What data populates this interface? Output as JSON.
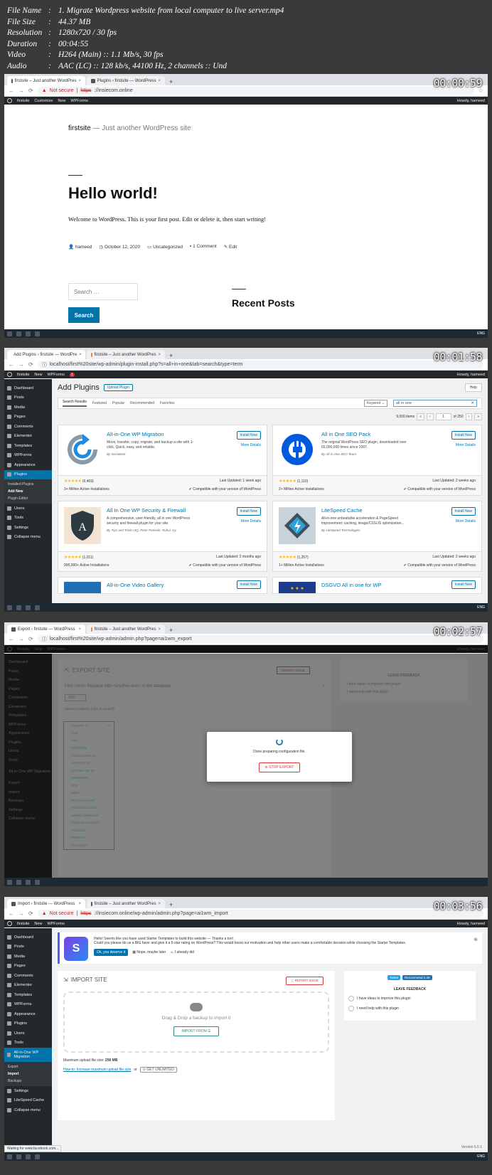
{
  "info": {
    "rows": [
      {
        "k": "File Name",
        "v": "1. Migrate Wordpress website from local computer to live server.mp4"
      },
      {
        "k": "File Size",
        "v": "44.37 MB"
      },
      {
        "k": "Resolution",
        "v": "1280x720 / 30 fps"
      },
      {
        "k": "Duration",
        "v": "00:04:55"
      },
      {
        "k": "Video",
        "v": "H264 (Main) :: 1.1 Mb/s, 30 fps"
      },
      {
        "k": "Audio",
        "v": "AAC (LC) :: 128 kb/s, 44100 Hz, 2 channels :: Und"
      }
    ]
  },
  "frame1": {
    "timestamp": "00:00:59",
    "tabs": [
      "firstsite – Just another WordPres",
      "Plugins ‹ firstsite — WordPress"
    ],
    "not_secure": "Not secure",
    "url_scheme": "https",
    "url_rest": "://insiecom.online",
    "adminbar": [
      "firstsite",
      "Customize",
      "New",
      "WPForms"
    ],
    "howdy": "Howdy, hameed",
    "site_title": "firstsite",
    "tagline": "Just another WordPress site",
    "post_title": "Hello world!",
    "post_body": "Welcome to WordPress. This is your first post. Edit or delete it, then start writing!",
    "meta": [
      "hameed",
      "October 12, 2020",
      "Uncategorized",
      "1 Comment",
      "Edit"
    ],
    "search_placeholder": "Search …",
    "search_button": "Search",
    "recent_posts": "Recent Posts",
    "tray": "ENG"
  },
  "frame2": {
    "timestamp": "00:01:58",
    "tabs": [
      "Add Plugins ‹ firstsite — WordPre",
      "firstsite – Just another WordPres"
    ],
    "url": "localhost/first%20site/wp-admin/plugin-install.php?s=all+in+one&tab=search&type=term",
    "adminbar": [
      "firstsite",
      "New",
      "WPForms"
    ],
    "badge": "1",
    "howdy": "Howdy, hameed",
    "sidebar": [
      "Dashboard",
      "Posts",
      "Media",
      "Pages",
      "Comments",
      "Elementor",
      "Templates",
      "WPForms",
      "Appearance",
      "Plugins"
    ],
    "submenu": [
      "Installed Plugins",
      "Add New",
      "Plugin Editor"
    ],
    "sidebar_after": [
      "Users",
      "Tools",
      "Settings",
      "Collapse menu"
    ],
    "page_title": "Add Plugins",
    "upload_button": "Upload Plugin",
    "help": "Help",
    "filter_tabs": [
      "Search Results",
      "Featured",
      "Popular",
      "Recommended",
      "Favorites"
    ],
    "keyword": "Keyword",
    "search_value": "all in one",
    "items": "9,000 items",
    "page_current": "1",
    "page_total": "of 250",
    "plugins": [
      {
        "name": "All-in-One WP Migration",
        "desc": "Move, transfer, copy, migrate, and backup a site with 1-click. Quick, easy, and reliable.",
        "by": "By ServMask",
        "rating": "(6,469)",
        "updated": "Last Updated: 1 week ago",
        "installs": "3+ Million Active Installations",
        "compat": "Compatible with your version of WordPress"
      },
      {
        "name": "All in One SEO Pack",
        "desc": "The original WordPress SEO plugin, downloaded over 65,000,000 times since 2007.",
        "by": "By All in One SEO Team",
        "rating": "(1,110)",
        "updated": "Last Updated: 2 weeks ago",
        "installs": "2+ Million Active Installations",
        "compat": "Compatible with your version of WordPress"
      },
      {
        "name": "All In One WP Security & Firewall",
        "desc": "A comprehensive, user-friendly, all in one WordPress security and firewall plugin for your site.",
        "by": "By Tips and Tricks HQ, Peter Petreski, Ruhul, Ivy",
        "rating": "(1,011)",
        "updated": "Last Updated: 2 months ago",
        "installs": "900,000+ Active Installations",
        "compat": "Compatible with your version of WordPress"
      },
      {
        "name": "LiteSpeed Cache",
        "desc": "All-in-one unbeatable acceleration & PageSpeed improvement: caching, image/CSS/JS optimization...",
        "by": "By LiteSpeed Technologies",
        "rating": "(1,257)",
        "updated": "Last Updated: 2 weeks ago",
        "installs": "1+ Million Active Installations",
        "compat": "Compatible with your version of WordPress"
      }
    ],
    "plugins_partial": [
      "All-in-One Video Gallery",
      "DSGVO All in one for WP"
    ],
    "install_now": "Install Now",
    "more_details": "More Details",
    "stars": "★★★★★"
  },
  "frame3": {
    "timestamp": "00:02:57",
    "tabs": [
      "Export ‹ firstsite — WordPress",
      "firstsite – Just another WordPres"
    ],
    "url": "localhost/first%20site/wp-admin/admin.php?page=ai1wm_export",
    "export_title": "EXPORT SITE",
    "report_issue": "REPORT ISSUE",
    "find_replace": "Find <text> Replace with <another-text> in the database",
    "add_btn": "ADD",
    "advanced": "Advanced options (click to expand)",
    "export_to": "EXPORT TO",
    "export_options": [
      "FILE",
      "FTP",
      "DROPBOX",
      "GOOGLE DRIVE",
      "AMAZON S3",
      "BACKBLAZE B2",
      "ONEDRIVE",
      "BOX",
      "MEGA",
      "DIGITALOCEAN",
      "GOOGLE CLOUD",
      "AZURE STORAGE",
      "AMAZON GLACIER",
      "PCLOUD",
      "WEBDAV",
      "S3 CLIENT"
    ],
    "leave_feedback": "LEAVE FEEDBACK",
    "feedback_opts": [
      "I have ideas to improve this plugin",
      "I need help with this plugin"
    ],
    "modal_text": "Done preparing configuration file.",
    "stop_export": "STOP EXPORT",
    "sidebar": [
      "Dashboard",
      "Posts",
      "Media",
      "Pages",
      "Comments",
      "Elementor",
      "Templates",
      "WPForms",
      "Appearance",
      "Plugins",
      "Users",
      "Tools",
      "All-in-One WP Migration",
      "Export",
      "Import",
      "Backups",
      "Settings",
      "Collapse menu"
    ]
  },
  "frame4": {
    "timestamp": "00:03:56",
    "tabs": [
      "Import ‹ firstsite — WordPress",
      "firstsite – Just another WordPres"
    ],
    "not_secure": "Not secure",
    "url_scheme": "https",
    "url_rest": "://insiecom.online/wp-admin/admin.php?page=ai1wm_import",
    "adminbar": [
      "firstsite",
      "New",
      "WPForms"
    ],
    "howdy": "Howdy, hameed",
    "notice_l1": "Hello! Seems like you have used Starter Templates to build this website — Thanks a ton!",
    "notice_l2": "Could you please do us a BIG favor and give it a 5-star rating on WordPress? This would boost our motivation and help other users make a comfortable decision while choosing the Starter Templates.",
    "notice_btns": [
      "Ok, you deserve it",
      "Nope, maybe later",
      "I already did"
    ],
    "import_title": "IMPORT SITE",
    "report_issue": "REPORT ISSUE",
    "drop_text": "Drag & Drop a backup to import it",
    "import_from": "IMPORT FROM",
    "max_label": "Maximum upload file size:",
    "max_value": "256 MB",
    "how_link": "How-to: Increase maximum upload file size",
    "or": "or",
    "get_unlimited": "GET UNLIMITED",
    "tweet": "Tweet",
    "recommend": "Recommend 2.4K",
    "leave_feedback": "LEAVE FEEDBACK",
    "feedback_opts": [
      "I have ideas to improve this plugin",
      "I need help with this plugin"
    ],
    "version": "Version 5.5.1",
    "status": "Waiting for www.facebook.com...",
    "sidebar": [
      "Dashboard",
      "Posts",
      "Media",
      "Pages",
      "Comments",
      "Elementor",
      "Templates",
      "WPForms",
      "Appearance",
      "Plugins",
      "Users",
      "Tools"
    ],
    "active_item": "All-in-One WP Migration",
    "submenu": [
      "Export",
      "Import",
      "Backups"
    ],
    "sidebar_after": [
      "Settings",
      "LiteSpeed Cache",
      "Collapse menu"
    ]
  }
}
